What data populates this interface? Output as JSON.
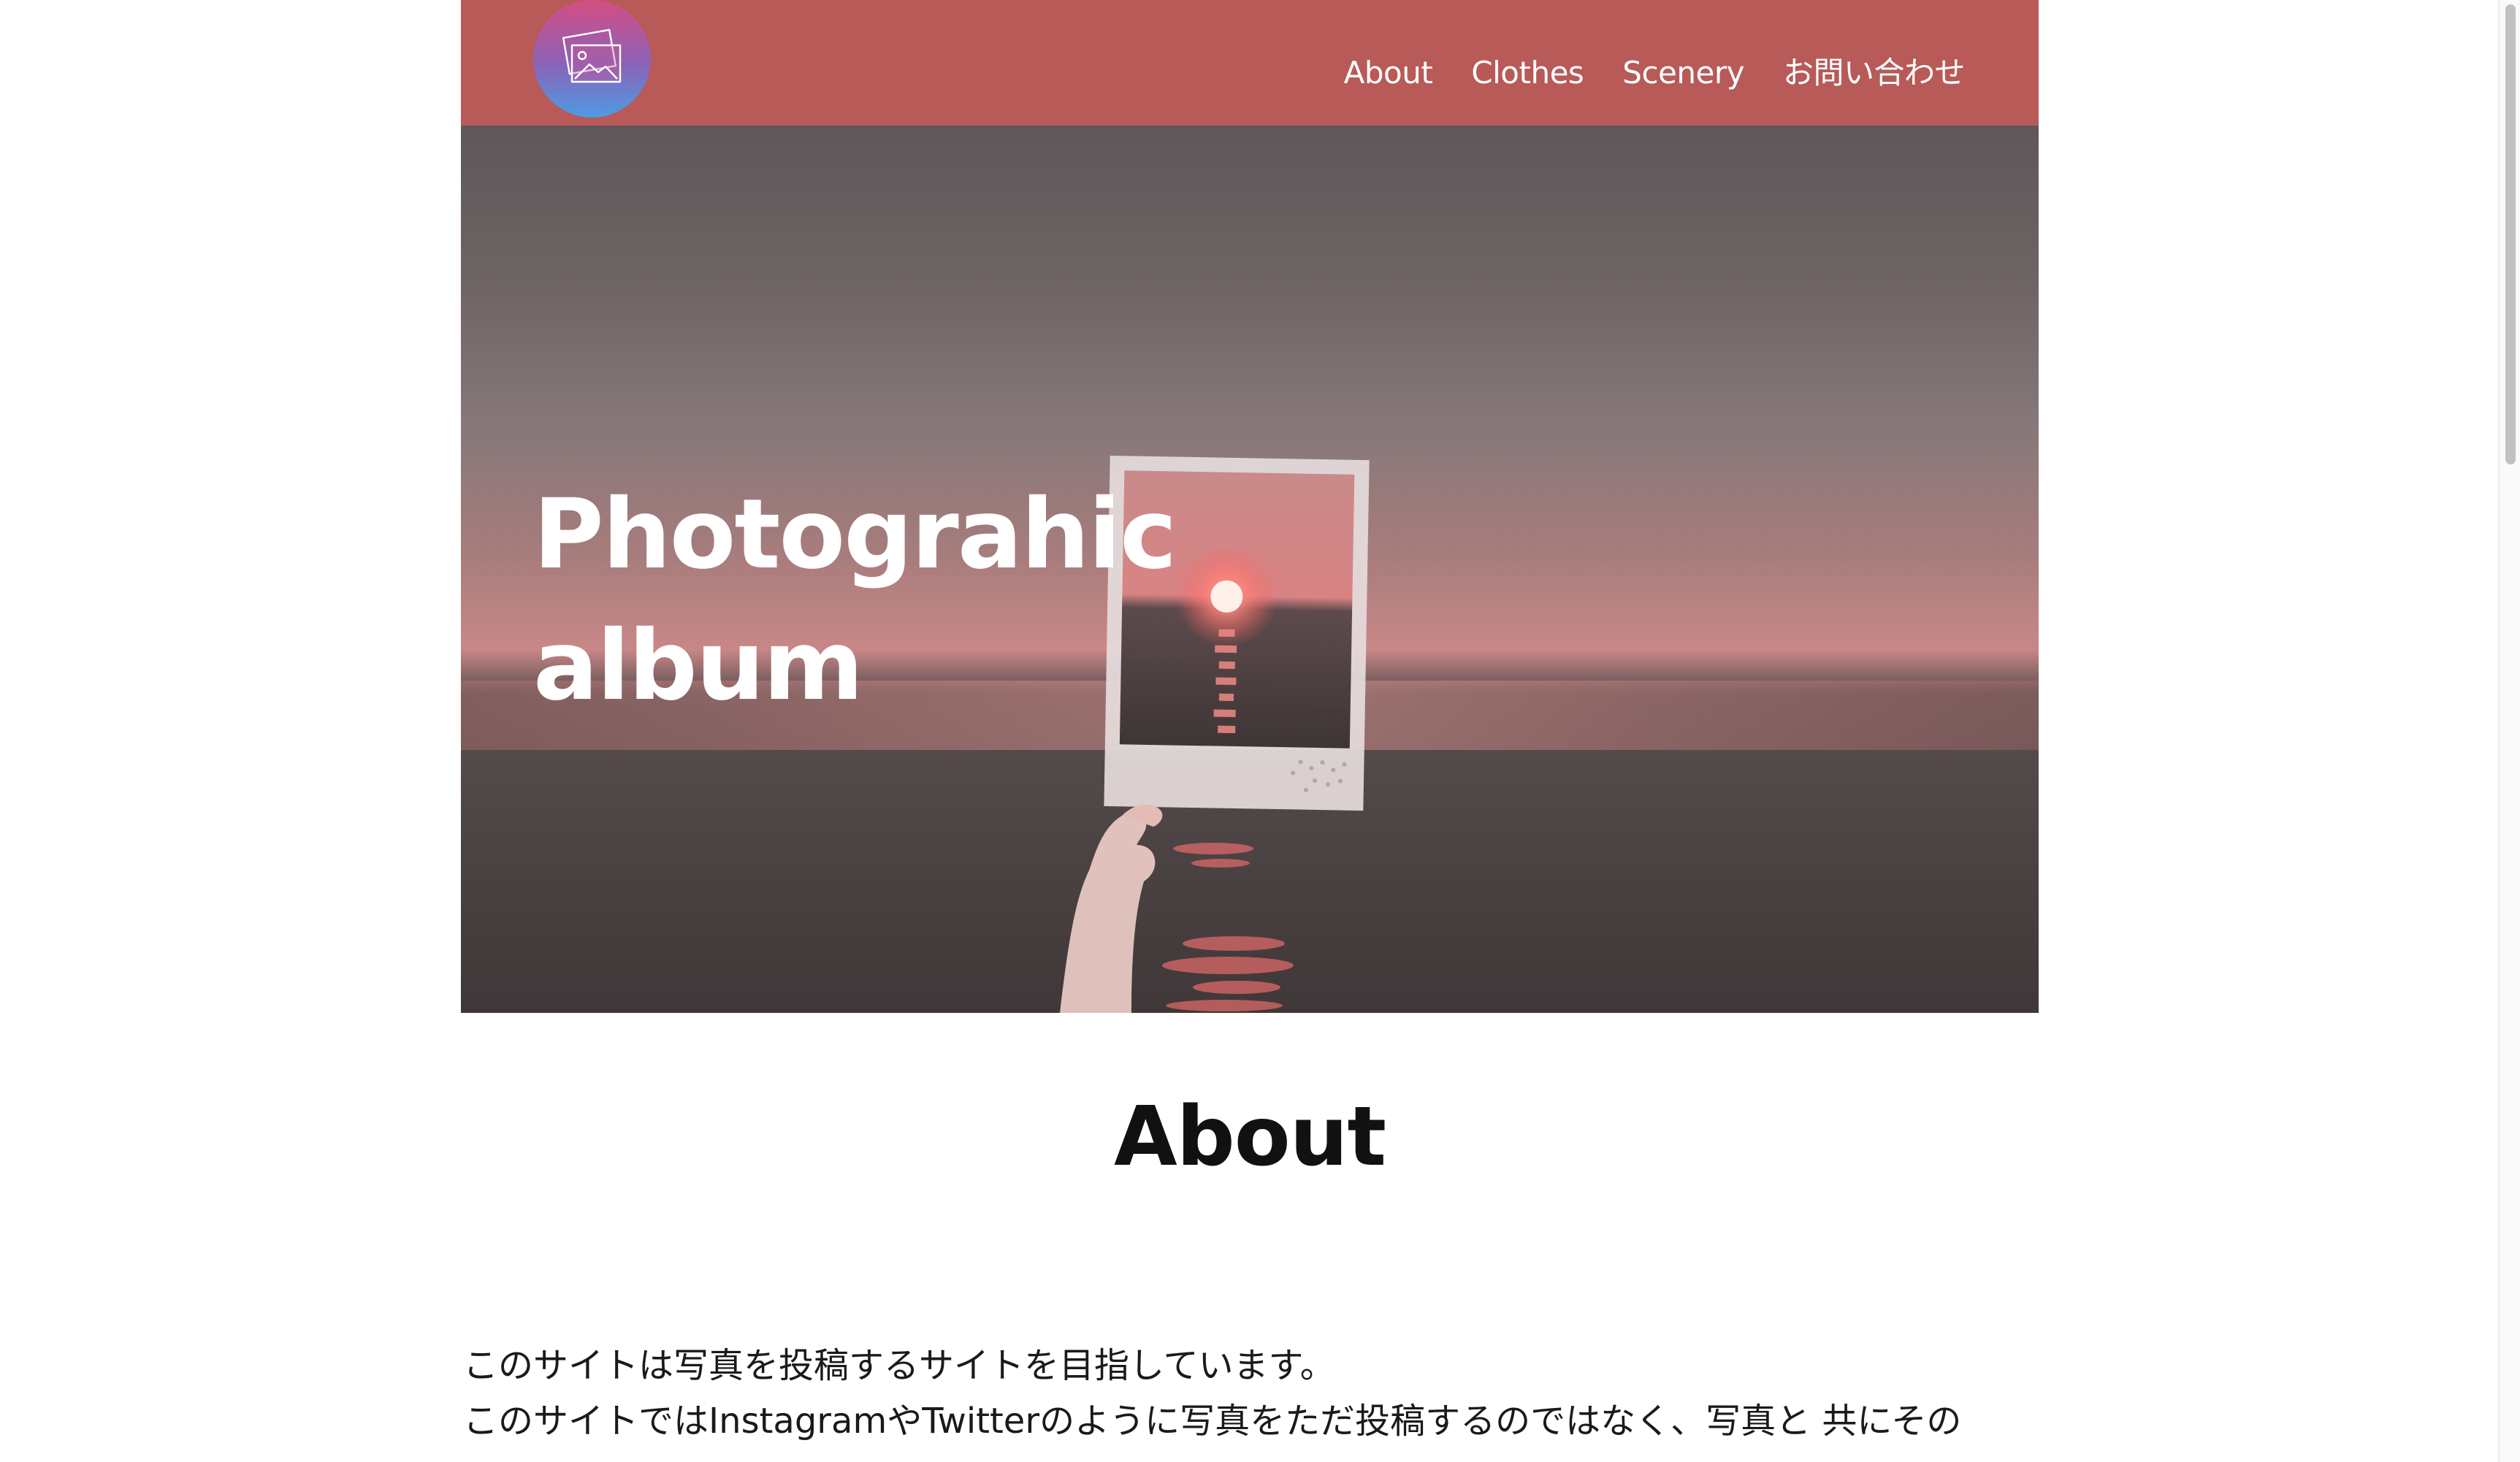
{
  "header": {
    "logo_icon": "photo-gallery-icon",
    "nav": [
      {
        "label": "About"
      },
      {
        "label": "Clothes"
      },
      {
        "label": "Scenery"
      },
      {
        "label": "お問い合わせ"
      }
    ],
    "colors": {
      "header_bg": "#b75a58",
      "nav_text": "#ffffff"
    }
  },
  "hero": {
    "title_line1": "Photograhic",
    "title_line2": "album"
  },
  "about": {
    "heading": "About",
    "paragraphs": [
      "このサイトは写真を投稿するサイトを目指しています。",
      "このサイトではInstagramやTwitterのように写真をただ投稿するのではなく、写真と 共にその"
    ]
  }
}
